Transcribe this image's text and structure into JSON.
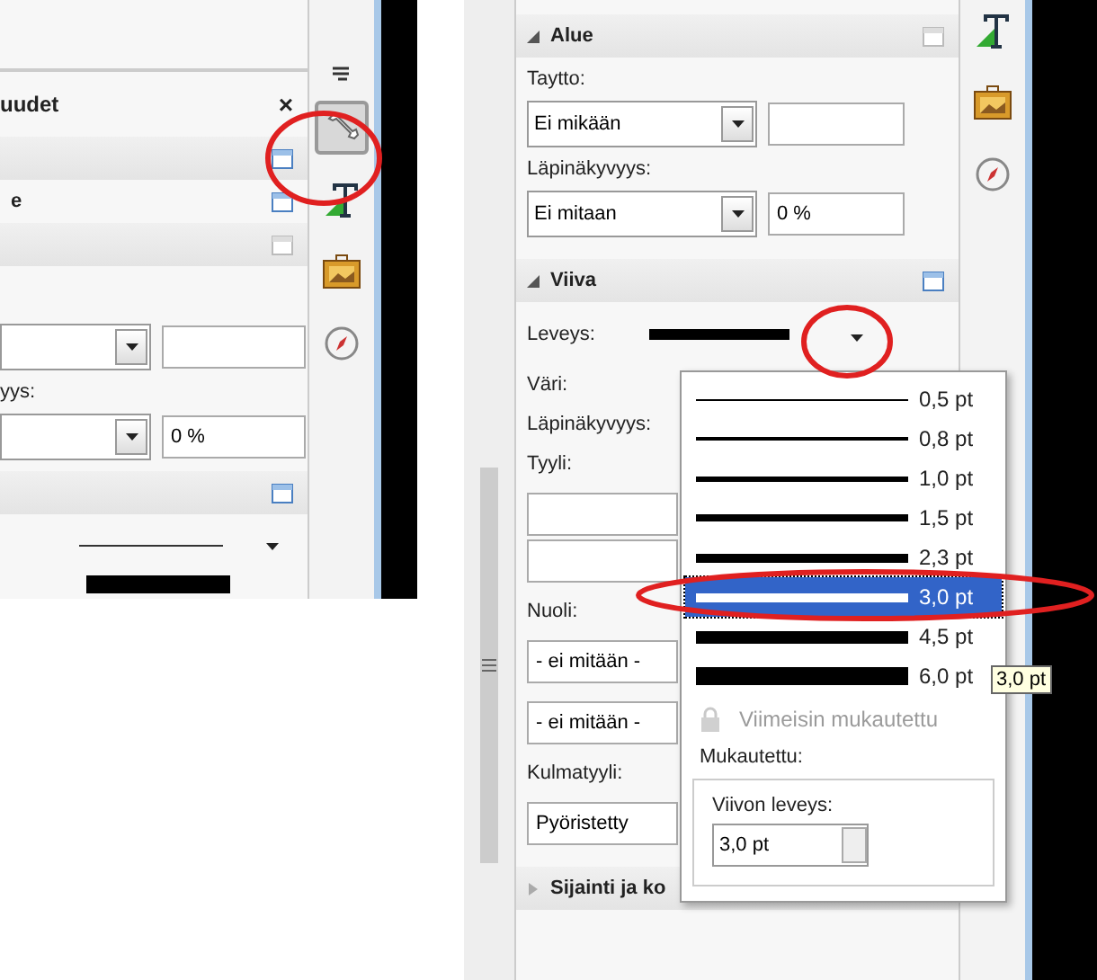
{
  "left_panel": {
    "title": "uudet",
    "close": "×",
    "section_title": "e",
    "transparency_label": "yys:",
    "transparency_value": "0 %",
    "tabs": [
      {
        "kind": "menu"
      },
      {
        "kind": "properties",
        "selected": true
      },
      {
        "kind": "styles",
        "selected": false
      },
      {
        "kind": "gallery",
        "selected": false
      },
      {
        "kind": "navigator",
        "selected": false
      }
    ]
  },
  "right_panel": {
    "tabs": [
      {
        "kind": "styles",
        "selected": false
      },
      {
        "kind": "gallery",
        "selected": false
      },
      {
        "kind": "navigator",
        "selected": false
      }
    ],
    "sections": [
      {
        "title": "Alue",
        "expanded": true,
        "rows": [
          {
            "kind": "label",
            "text": "Taytto:"
          },
          {
            "kind": "combo",
            "value": "Ei mikään",
            "extra": ""
          },
          {
            "kind": "label",
            "text": "Läpinäkyvyys:"
          },
          {
            "kind": "combo",
            "value": "Ei mitaan",
            "extra": "0 %"
          }
        ]
      },
      {
        "title": "Viiva",
        "expanded": true,
        "rows": [
          {
            "kind": "width",
            "text": "Leveys:"
          },
          {
            "kind": "label",
            "text": "Väri:"
          },
          {
            "kind": "label",
            "text": "Läpinäkyvyys:"
          },
          {
            "kind": "label",
            "text": "Tyyli:"
          },
          {
            "kind": "styles"
          },
          {
            "kind": "label",
            "text": "Nuoli:"
          },
          {
            "kind": "field",
            "value": "- ei mitään -"
          },
          {
            "kind": "field",
            "value": "- ei mitään -"
          },
          {
            "kind": "label",
            "text": "Kulmatyyli:"
          },
          {
            "kind": "field",
            "value": "Pyöristetty"
          }
        ]
      },
      {
        "title": "Sijainti ja ko",
        "expanded": false
      }
    ]
  },
  "width_popup": {
    "options": [
      {
        "label": "0,5 pt",
        "selected": false
      },
      {
        "label": "0,8 pt",
        "selected": false
      },
      {
        "label": "1,0 pt",
        "selected": false
      },
      {
        "label": "1,5 pt",
        "selected": false
      },
      {
        "label": "2,3 pt",
        "selected": false
      },
      {
        "label": "3,0 pt",
        "selected": true
      },
      {
        "label": "4,5 pt",
        "selected": false
      },
      {
        "label": "6,0 pt",
        "selected": false
      }
    ],
    "recent": {
      "label": "Viimeisin mukautettu",
      "disabled": true
    },
    "custom_label": "Mukautettu:",
    "field_label": "Viivon leveys:",
    "field_value": "3,0 pt",
    "tooltip": "3,0 pt"
  }
}
